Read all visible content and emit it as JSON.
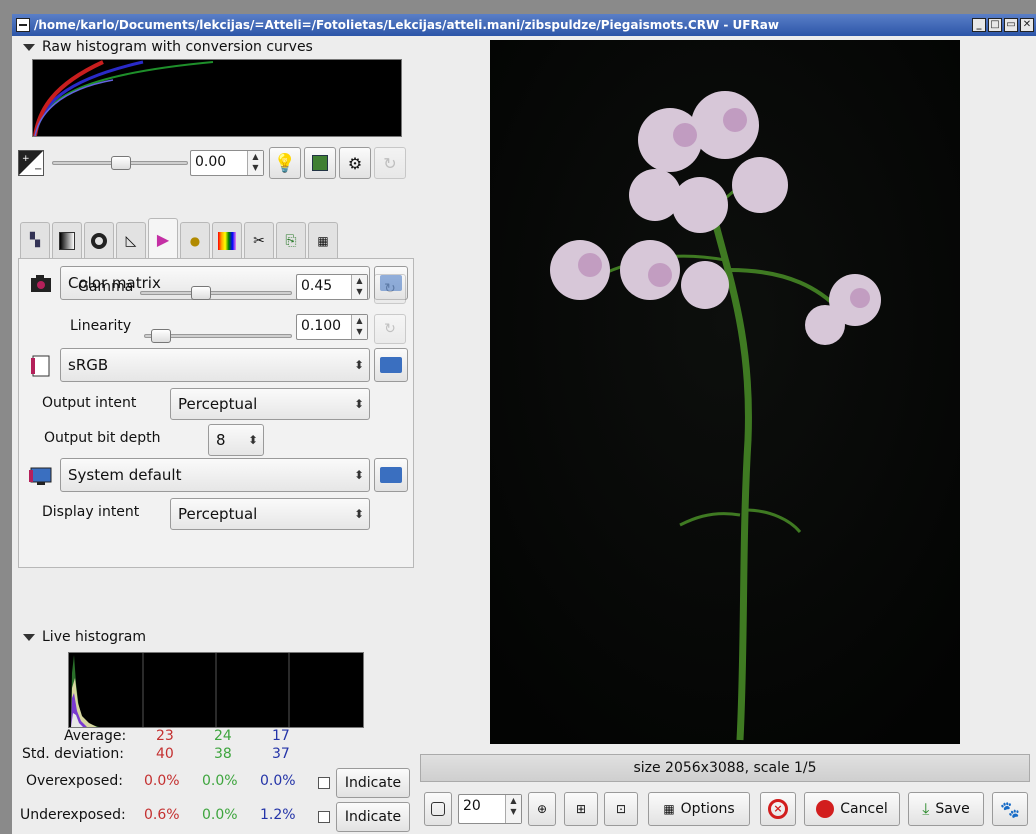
{
  "window": {
    "title": "/home/karlo/Documents/lekcijas/=Atteli=/Fotolietas/Lekcijas/atteli.mani/zibspuldze/Piegaismots.CRW - UFRaw"
  },
  "raw_histogram": {
    "header": "Raw histogram with conversion curves"
  },
  "exposure": {
    "value": "0.00",
    "slider_level": 0.5
  },
  "color_management": {
    "input_profile": "Color matrix",
    "gamma_label": "Gamma",
    "gamma_value": "0.45",
    "linearity_label": "Linearity",
    "linearity_value": "0.100",
    "output_profile": "sRGB",
    "output_intent_label": "Output intent",
    "output_intent_value": "Perceptual",
    "output_bit_depth_label": "Output bit depth",
    "output_bit_depth_value": "8",
    "display_profile": "System default",
    "display_intent_label": "Display intent",
    "display_intent_value": "Perceptual"
  },
  "live_histogram": {
    "header": "Live histogram",
    "average_label": "Average:",
    "average": {
      "r": "23",
      "g": "24",
      "b": "17"
    },
    "stddev_label": "Std. deviation:",
    "stddev": {
      "r": "40",
      "g": "38",
      "b": "37"
    },
    "overexposed_label": "Overexposed:",
    "overexposed": {
      "r": "0.0%",
      "g": "0.0%",
      "b": "0.0%"
    },
    "underexposed_label": "Underexposed:",
    "underexposed": {
      "r": "0.6%",
      "g": "0.0%",
      "b": "1.2%"
    },
    "indicate_label": "Indicate"
  },
  "preview": {
    "status": "size 2056x3088, scale 1/5"
  },
  "bottom_bar": {
    "zoom_value": "20",
    "options_label": "Options",
    "cancel_label": "Cancel",
    "save_label": "Save"
  },
  "colors": {
    "accent_blue": "#2c55a8",
    "cancel_red": "#d21e1e",
    "photo_bg": "#050605"
  }
}
